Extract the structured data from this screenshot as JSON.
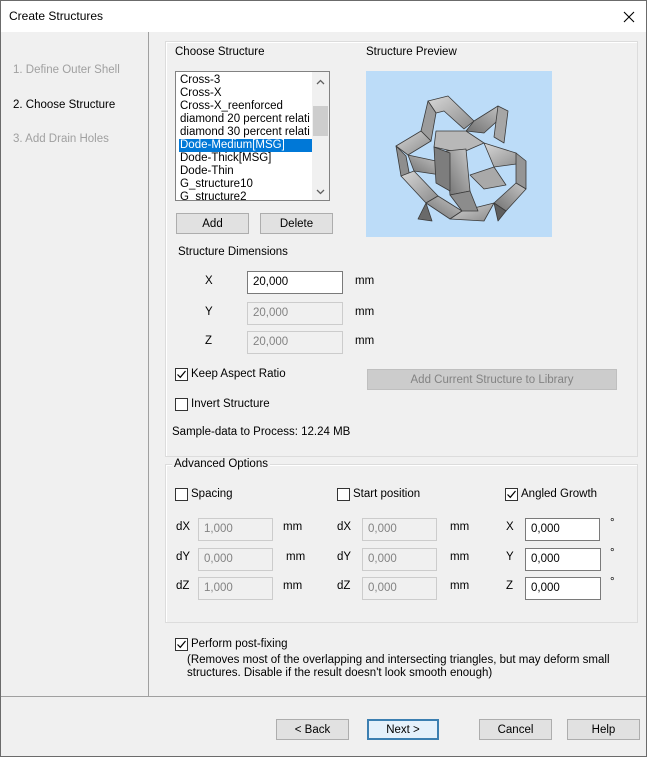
{
  "window": {
    "title": "Create Structures",
    "close_icon": "close-icon"
  },
  "sidebar": {
    "steps": [
      {
        "label": "1. Define Outer Shell",
        "active": false
      },
      {
        "label": "2. Choose Structure",
        "active": true
      },
      {
        "label": "3. Add Drain Holes",
        "active": false
      }
    ]
  },
  "choose_structure": {
    "heading": "Choose Structure",
    "items": [
      "Cross-3",
      "Cross-X",
      "Cross-X_reenforced",
      "diamond 20 percent relati",
      "diamond 30 percent relati",
      "Dode-Medium[MSG]",
      "Dode-Thick[MSG]",
      "Dode-Thin",
      "G_structure10",
      "G_structure2"
    ],
    "selected": "Dode-Medium[MSG]",
    "add_label": "Add",
    "delete_label": "Delete"
  },
  "preview": {
    "heading": "Structure Preview",
    "image": "dodecahedron-lattice-preview",
    "background": "#bcdcf8"
  },
  "dimensions": {
    "heading": "Structure Dimensions",
    "x": {
      "label": "X",
      "value": "20,000",
      "unit": "mm"
    },
    "y": {
      "label": "Y",
      "value": "20,000",
      "unit": "mm"
    },
    "z": {
      "label": "Z",
      "value": "20,000",
      "unit": "mm"
    }
  },
  "options": {
    "keep_aspect_ratio": {
      "label": "Keep Aspect Ratio",
      "checked": true
    },
    "invert_structure": {
      "label": "Invert Structure",
      "checked": false
    },
    "add_to_library_label": "Add Current Structure to Library",
    "sample_data": "Sample-data to Process: 12.24 MB"
  },
  "advanced": {
    "heading": "Advanced Options",
    "spacing": {
      "label": "Spacing",
      "checked": false,
      "fields": [
        {
          "label": "dX",
          "value": "1,000",
          "unit": "mm"
        },
        {
          "label": "dY",
          "value": "0,000",
          "unit": "mm"
        },
        {
          "label": "dZ",
          "value": "1,000",
          "unit": "mm"
        }
      ]
    },
    "start_position": {
      "label": "Start position",
      "checked": false,
      "fields": [
        {
          "label": "dX",
          "value": "0,000",
          "unit": "mm"
        },
        {
          "label": "dY",
          "value": "0,000",
          "unit": "mm"
        },
        {
          "label": "dZ",
          "value": "0,000",
          "unit": "mm"
        }
      ]
    },
    "angled_growth": {
      "label": "Angled Growth",
      "checked": true,
      "fields": [
        {
          "label": "X",
          "value": "0,000",
          "unit": "°"
        },
        {
          "label": "Y",
          "value": "0,000",
          "unit": "°"
        },
        {
          "label": "Z",
          "value": "0,000",
          "unit": "°"
        }
      ]
    }
  },
  "post_fixing": {
    "label": "Perform post-fixing",
    "checked": true,
    "description_line1": "(Removes most of the overlapping and intersecting triangles, but may deform small",
    "description_line2": "structures. Disable if the result doesn't look smooth enough)"
  },
  "footer": {
    "back_label": "< Back",
    "next_label": "Next >",
    "cancel_label": "Cancel",
    "help_label": "Help"
  }
}
